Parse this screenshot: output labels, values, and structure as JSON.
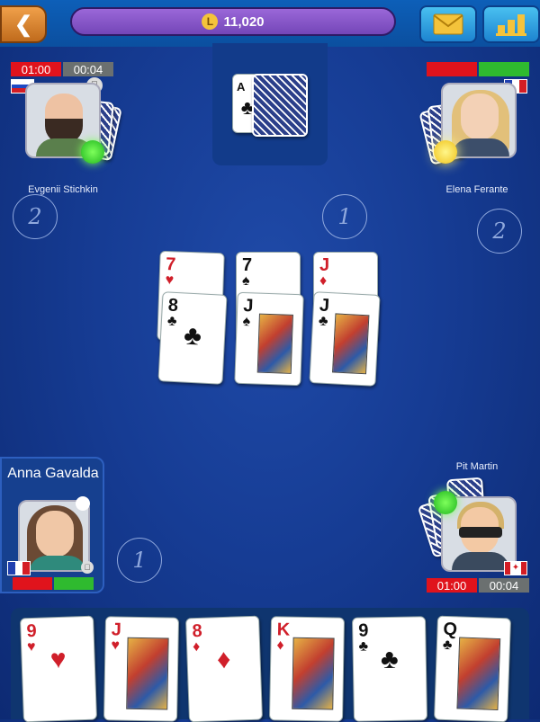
{
  "top_bar": {
    "back_icon": "chevron-left-icon",
    "coin_symbol": "L",
    "coin_balance": "11,020",
    "mail_icon": "mail-icon",
    "stats_icon": "leaderboard-icon"
  },
  "deck": {
    "trump_card": {
      "rank": "A",
      "suit": "♣",
      "color": "black"
    }
  },
  "players": {
    "top_left": {
      "name": "Evgenii Stichkin",
      "timer_left": "01:00",
      "timer_right": "00:04",
      "flag": "russia",
      "platform_icon": "apple-icon",
      "score": "2",
      "status": "active"
    },
    "top_right": {
      "name": "Elena Ferante",
      "timer_left": "",
      "timer_right": "",
      "flag": "france",
      "score": "2",
      "status": "thinking"
    },
    "bottom_left": {
      "name": "Anna Gavalda",
      "flag": "france",
      "platform_icon": "apple-icon",
      "score": "1"
    },
    "bottom_right": {
      "name": "Pit Martin",
      "timer_left": "01:00",
      "timer_right": "00:04",
      "flag": "canada",
      "score": "",
      "status": "active"
    }
  },
  "center_score": "1",
  "table_cards": [
    {
      "rank": "7",
      "suit": "♥",
      "color": "red"
    },
    {
      "rank": "7",
      "suit": "♠",
      "color": "black"
    },
    {
      "rank": "J",
      "suit": "♦",
      "color": "red"
    },
    {
      "rank": "8",
      "suit": "♣",
      "color": "black"
    },
    {
      "rank": "J",
      "suit": "♠",
      "color": "black"
    },
    {
      "rank": "J",
      "suit": "♣",
      "color": "black"
    }
  ],
  "hand": [
    {
      "rank": "9",
      "suit": "♥",
      "color": "red"
    },
    {
      "rank": "J",
      "suit": "♥",
      "color": "red"
    },
    {
      "rank": "8",
      "suit": "♦",
      "color": "red"
    },
    {
      "rank": "K",
      "suit": "♦",
      "color": "red"
    },
    {
      "rank": "9",
      "suit": "♣",
      "color": "black"
    },
    {
      "rank": "Q",
      "suit": "♣",
      "color": "black"
    }
  ]
}
